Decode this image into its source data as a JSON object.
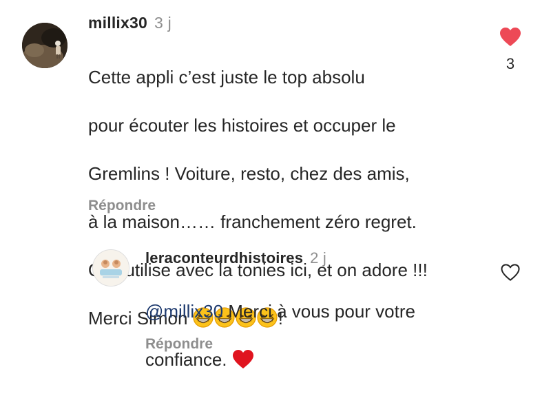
{
  "comments": [
    {
      "username": "millix30",
      "time": "3 j",
      "lines": [
        "Cette appli c’est juste le top absolu",
        "pour écouter les histoires et occuper le",
        "Gremlins ! Voiture, resto, chez des amis,",
        "à la maison…… franchement zéro regret.",
        "On l’utilise avec la tonies ici, et on adore !!!"
      ],
      "last_line_prefix": "Merci Simon ",
      "last_line_emojis": [
        "grinning-squint-emoji",
        "grinning-squint-emoji",
        "grinning-squint-emoji",
        "grinning-squint-emoji"
      ],
      "last_line_suffix": "!",
      "reply_label": "Répondre",
      "liked": true,
      "like_count": "3",
      "like_icon": "heart-filled-icon",
      "like_color": "#ed4956"
    },
    {
      "username": "leraconteurdhistoires",
      "time": "2 j",
      "mention": "@millix30",
      "text_line1": " Merci à vous pour votre",
      "text_line2": "confiance.",
      "trailing_emoji": "red-heart-emoji",
      "reply_label": "Répondre",
      "liked": false,
      "like_icon": "heart-outline-icon"
    }
  ],
  "colors": {
    "text": "#262626",
    "secondary": "#8e8e8e",
    "mention": "#1e3a6e",
    "heart": "#ed4956"
  }
}
